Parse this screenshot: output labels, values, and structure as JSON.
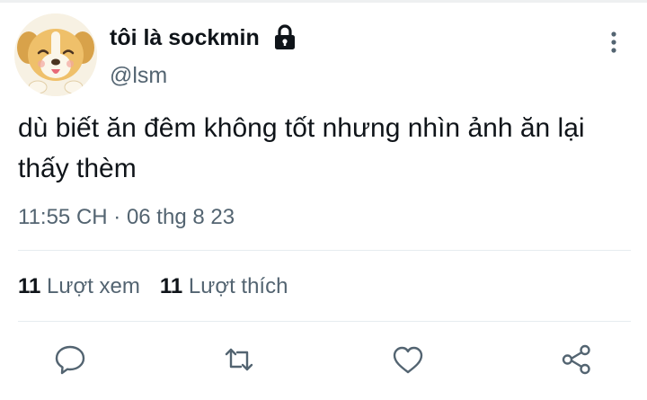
{
  "author": {
    "display_name": "tôi là sockmin",
    "handle": "@lsm",
    "protected": true
  },
  "tweet": {
    "text": "dù biết ăn đêm không tốt nhưng nhìn ảnh ăn lại thấy thèm",
    "timestamp": "11:55 CH · 06 thg 8 23"
  },
  "stats": {
    "views_count": "11",
    "views_label": "Lượt xem",
    "likes_count": "11",
    "likes_label": "Lượt thích"
  },
  "actions": {
    "reply_icon": "reply-icon",
    "retweet_icon": "retweet-icon",
    "like_icon": "heart-icon",
    "share_icon": "share-icon"
  },
  "colors": {
    "text_primary": "#0f1419",
    "text_secondary": "#536471",
    "divider": "#e6ecf0",
    "icon": "#536471"
  }
}
